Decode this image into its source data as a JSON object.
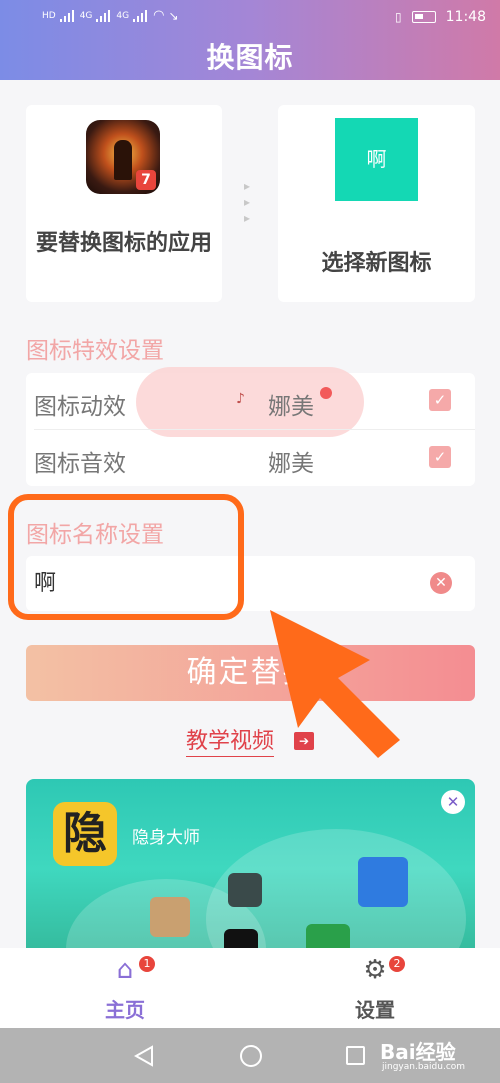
{
  "status_bar": {
    "left_labels": [
      "HD",
      "4G",
      "4G"
    ],
    "time": "11:48"
  },
  "header": {
    "title": "换图标"
  },
  "app_card": {
    "label": "要替换图标的应用",
    "icon": "game-app-icon"
  },
  "new_icon_card": {
    "icon_text": "啊",
    "label": "选择新图标",
    "icon_color": "#14d8b4"
  },
  "effects_section": {
    "title": "图标特效设置",
    "rows": [
      {
        "label": "图标动效",
        "value": "娜美",
        "checked": true
      },
      {
        "label": "图标音效",
        "value": "娜美",
        "checked": true
      }
    ]
  },
  "name_section": {
    "title": "图标名称设置",
    "input_value": "啊"
  },
  "confirm_button": {
    "label": "确定替换"
  },
  "tutorial_link": {
    "label": "教学视频"
  },
  "ad": {
    "logo_text": "隐",
    "title": "隐身大师"
  },
  "tabbar": {
    "tabs": [
      {
        "label": "主页",
        "badge": "1",
        "icon": "home-icon",
        "active": true
      },
      {
        "label": "设置",
        "badge": "2",
        "icon": "gear-icon",
        "active": false
      }
    ]
  },
  "watermark": {
    "text": "Bai经验",
    "sub": "jingyan.baidu.com"
  },
  "colors": {
    "accent_purple": "#8a6fd6",
    "pink": "#f5a9a9",
    "orange_annotation": "#ff6a1a",
    "link_red": "#e0424a"
  }
}
